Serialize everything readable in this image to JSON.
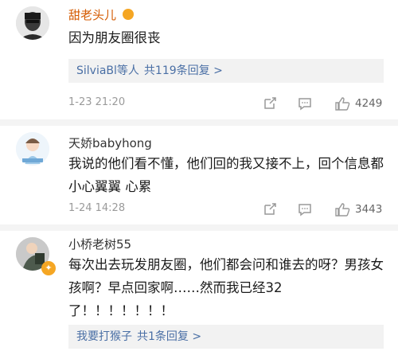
{
  "comments": [
    {
      "username": "甜老头儿",
      "text": "因为朋友圈很丧",
      "reply_users": "SilviaBl等人",
      "reply_count": "共119条回复 >",
      "time": "1-23 21:20",
      "likes": "4249"
    },
    {
      "username": "天娇babyhong",
      "text": "我说的他们看不懂，他们回的我又接不上，回个信息都小心翼翼 心累",
      "time": "1-24 14:28",
      "likes": "3443"
    },
    {
      "username": "小桥老树55",
      "text": "每次出去玩发朋友圈，他们都会问和谁去的呀？男孩女孩啊？早点回家啊……然而我已经32了！！！！！！！",
      "reply_users": "我要打猴子",
      "reply_count": "共1条回复 >"
    }
  ],
  "colors": {
    "accent_orange": "#d45a00",
    "link_blue": "#4a6fa5",
    "badge": "#f5a623"
  },
  "icons": [
    "share-icon",
    "comment-icon",
    "like-icon",
    "vip-badge-icon"
  ]
}
